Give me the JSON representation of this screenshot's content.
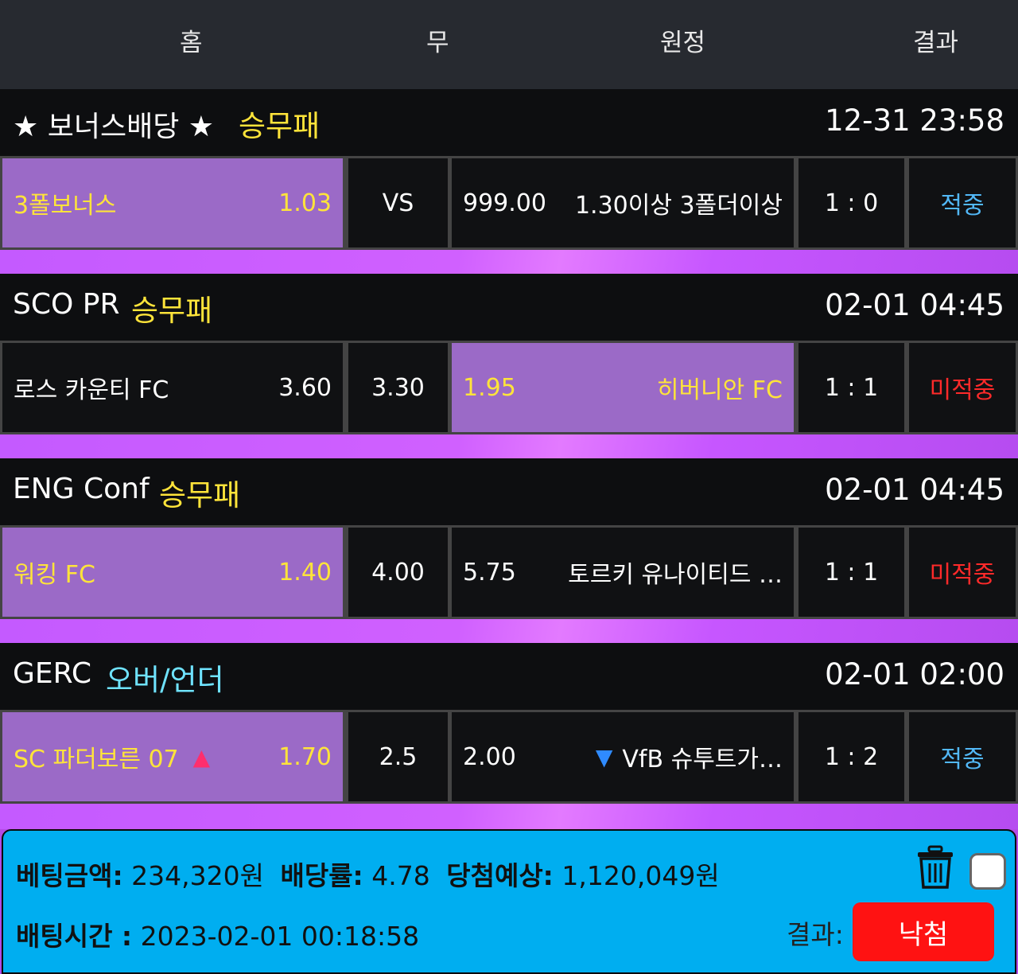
{
  "header": {
    "home": "홈",
    "draw": "무",
    "away": "원정",
    "result": "결과"
  },
  "games": [
    {
      "league": "★ 보너스배당 ★",
      "type": "승무패",
      "type_color": "#ffe43a",
      "time": "12-31 23:58",
      "home_team": "3폴보너스",
      "home_odds": "1.03",
      "mid": "VS",
      "away_odds": "999.00",
      "away_team": "1.30이상 3폴더이상",
      "score": "1 : 0",
      "result": "적중"
    },
    {
      "league": "SCO PR",
      "type": "승무패",
      "type_color": "#ffe43a",
      "time": "02-01 04:45",
      "home_team": "로스 카운티 FC",
      "home_odds": "3.60",
      "mid": "3.30",
      "away_odds": "1.95",
      "away_team": "히버니안 FC",
      "score": "1 : 1",
      "result": "미적중"
    },
    {
      "league": "ENG Conf",
      "type": "승무패",
      "type_color": "#ffe43a",
      "time": "02-01 04:45",
      "home_team": "워킹 FC",
      "home_odds": "1.40",
      "mid": "4.00",
      "away_odds": "5.75",
      "away_team": "토르키 유나이티드 …",
      "score": "1 : 1",
      "result": "미적중"
    },
    {
      "league": "GERC",
      "type": "오버/언더",
      "type_color": "#6fe3ff",
      "time": "02-01 02:00",
      "home_team": "SC 파더보른 07",
      "home_arrow": "▲",
      "home_odds": "1.70",
      "mid": "2.5",
      "away_odds": "2.00",
      "away_arrow": "▼",
      "away_team": "VfB 슈투트가…",
      "score": "1 : 2",
      "result": "적중"
    }
  ],
  "summary": {
    "bet_amount_label": "베팅금액:",
    "bet_amount": "234,320원",
    "odds_label": "배당률:",
    "odds": "4.78",
    "expected_label": "당첨예상:",
    "expected": "1,120,049원",
    "bet_time_label": "배팅시간 :",
    "bet_time": "2023-02-01 00:18:58",
    "result_label": "결과:",
    "result_button": "낙첨",
    "trash_icon": "trash-icon"
  }
}
